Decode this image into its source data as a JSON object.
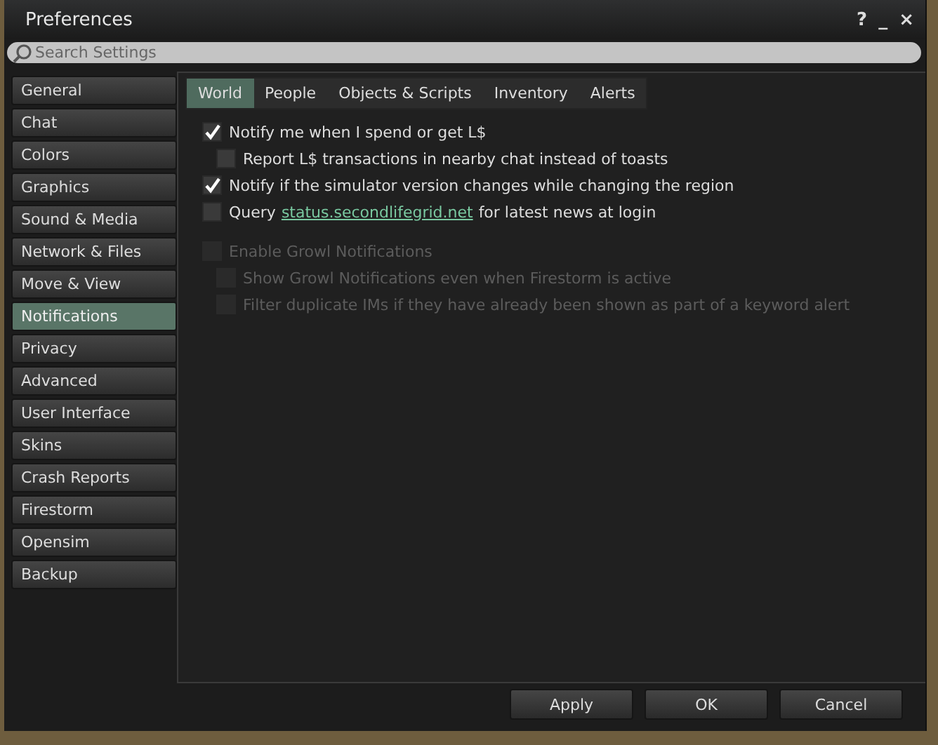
{
  "window": {
    "title": "Preferences",
    "controls": [
      "?",
      "_",
      "×"
    ]
  },
  "search": {
    "placeholder": "Search Settings"
  },
  "sidebar": {
    "items": [
      {
        "label": "General",
        "selected": false
      },
      {
        "label": "Chat",
        "selected": false
      },
      {
        "label": "Colors",
        "selected": false
      },
      {
        "label": "Graphics",
        "selected": false
      },
      {
        "label": "Sound & Media",
        "selected": false
      },
      {
        "label": "Network & Files",
        "selected": false
      },
      {
        "label": "Move & View",
        "selected": false
      },
      {
        "label": "Notifications",
        "selected": true
      },
      {
        "label": "Privacy",
        "selected": false
      },
      {
        "label": "Advanced",
        "selected": false
      },
      {
        "label": "User Interface",
        "selected": false
      },
      {
        "label": "Skins",
        "selected": false
      },
      {
        "label": "Crash Reports",
        "selected": false
      },
      {
        "label": "Firestorm",
        "selected": false
      },
      {
        "label": "Opensim",
        "selected": false
      },
      {
        "label": "Backup",
        "selected": false
      }
    ]
  },
  "tabs": [
    {
      "label": "World",
      "selected": true
    },
    {
      "label": "People",
      "selected": false
    },
    {
      "label": "Objects & Scripts",
      "selected": false
    },
    {
      "label": "Inventory",
      "selected": false
    },
    {
      "label": "Alerts",
      "selected": false
    }
  ],
  "groups": [
    {
      "options": [
        {
          "kind": "checkbox",
          "label": "Notify me when I spend or get L$",
          "checked": true,
          "disabled": false,
          "children": [
            {
              "kind": "checkbox",
              "label": "Report L$ transactions in nearby chat instead of toasts",
              "checked": false,
              "disabled": false
            }
          ]
        },
        {
          "kind": "checkbox",
          "label": "Notify if the simulator version changes while changing the region",
          "checked": true,
          "disabled": false
        },
        {
          "kind": "link",
          "label": "Query",
          "link": "status.secondlifegrid.net",
          "label_after": "for latest news at login",
          "checked": false,
          "disabled": false
        }
      ]
    },
    {
      "options": [
        {
          "kind": "checkbox",
          "label": "Enable Growl Notifications",
          "checked": false,
          "disabled": true,
          "children": [
            {
              "kind": "checkbox",
              "label": "Show Growl Notifications even when Firestorm is active",
              "checked": false,
              "disabled": true
            },
            {
              "kind": "checkbox",
              "label": "Filter duplicate IMs if they have already been shown as part of a keyword alert",
              "checked": false,
              "disabled": true
            }
          ]
        }
      ]
    }
  ],
  "buttons": [
    "Apply",
    "OK",
    "Cancel"
  ]
}
